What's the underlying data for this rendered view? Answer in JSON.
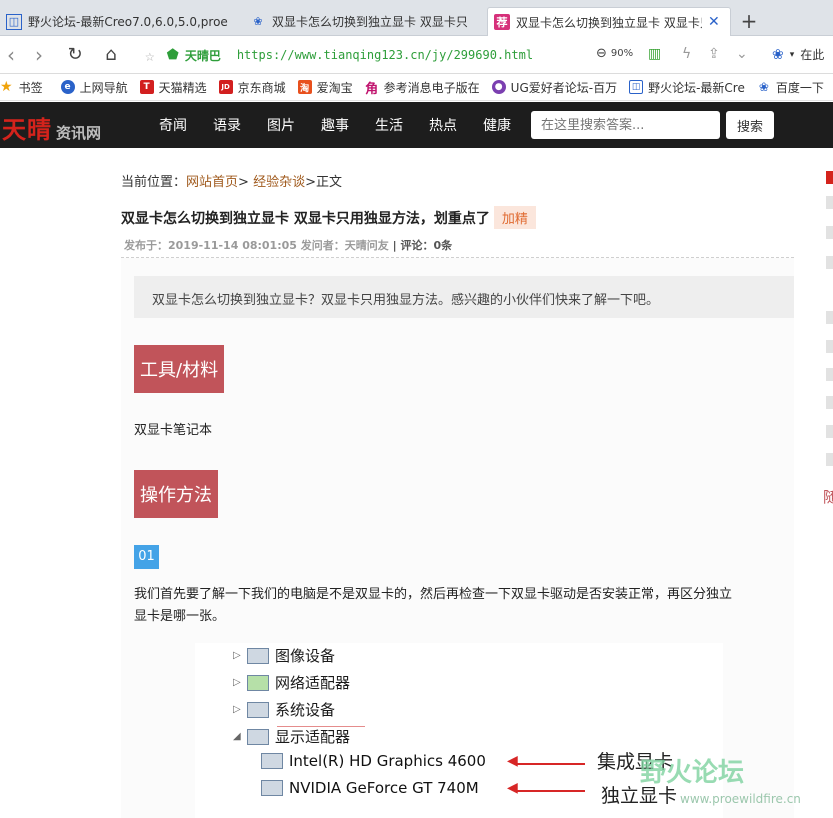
{
  "tabs": [
    {
      "label": "野火论坛-最新Creo7.0,6.0,5.0,proe",
      "favicon": "doc-icon",
      "active": false
    },
    {
      "label": "双显卡怎么切换到独立显卡 双显卡只",
      "favicon": "paw-icon",
      "active": false
    },
    {
      "label": "双显卡怎么切换到独立显卡 双显卡只",
      "favicon": "jian-icon",
      "favicon_text": "荐",
      "active": true
    }
  ],
  "address": {
    "site_name": "天晴巴",
    "url": "https://www.tianqing123.cn/jy/299690.html",
    "zoom": "90%",
    "right_label": "在此"
  },
  "bookmarks": [
    {
      "label": "书签",
      "icon": "star-icon"
    },
    {
      "label": "上网导航",
      "icon": "e-icon"
    },
    {
      "label": "天猫精选",
      "icon": "tmall-icon",
      "icon_text": "T"
    },
    {
      "label": "京东商城",
      "icon": "jd-icon",
      "icon_text": "JD"
    },
    {
      "label": "爱淘宝",
      "icon": "taobao-icon",
      "icon_text": "淘"
    },
    {
      "label": "参考消息电子版在",
      "icon": "reference-icon",
      "icon_text": "角"
    },
    {
      "label": "UG爱好者论坛-百万",
      "icon": "ug-icon"
    },
    {
      "label": "野火论坛-最新Cre",
      "icon": "doc-icon"
    },
    {
      "label": "百度一下",
      "icon": "paw-icon"
    }
  ],
  "site": {
    "logo_main": "天晴",
    "logo_sub": "资讯网",
    "nav": [
      "奇闻",
      "语录",
      "图片",
      "趣事",
      "生活",
      "热点",
      "健康"
    ],
    "search_placeholder": "在这里搜索答案...",
    "search_button": "搜索"
  },
  "article": {
    "breadcrumb_prefix": "当前位置：",
    "breadcrumb_home": "网站首页",
    "breadcrumb_sep1": "> ",
    "breadcrumb_category": "经验杂谈",
    "breadcrumb_current": ">正文",
    "title": "双显卡怎么切换到独立显卡 双显卡只用独显方法，划重点了",
    "tag": "加精",
    "meta_published": "发布于：2019-11-14 08:01:05",
    "meta_author": " 发问者：天晴问友",
    "meta_comments": " | 评论：0条",
    "summary": "双显卡怎么切换到独立显卡？双显卡只用独显方法。感兴趣的小伙伴们快来了解一下吧。",
    "section_tools": "工具/材料",
    "tools_text": "双显卡笔记本",
    "section_method": "操作方法",
    "step_number": "01",
    "step1_text_line1": "我们首先要了解一下我们的电脑是不是双显卡的，然后再检查一下双显卡驱动是否安装正常，再区分独立",
    "step1_text_line2": "显卡是哪一张。"
  },
  "screenshot": {
    "devices": [
      "图像设备",
      "网络适配器",
      "系统设备",
      "显示适配器"
    ],
    "gpu_integrated": "Intel(R) HD Graphics 4600",
    "gpu_discrete": "NVIDIA GeForce GT 740M",
    "label_integrated": "集成显卡",
    "label_discrete": "独立显卡",
    "watermark": "野火论坛",
    "watermark_url": "www.proewildfire.cn"
  },
  "sidebar": {
    "partial_text": "随"
  },
  "colors": {
    "accent_red": "#c1545a",
    "logo_red": "#d4231c",
    "link_brown": "#a05a1d",
    "url_green": "#2e9e3a",
    "step_blue": "#44a3e7"
  }
}
